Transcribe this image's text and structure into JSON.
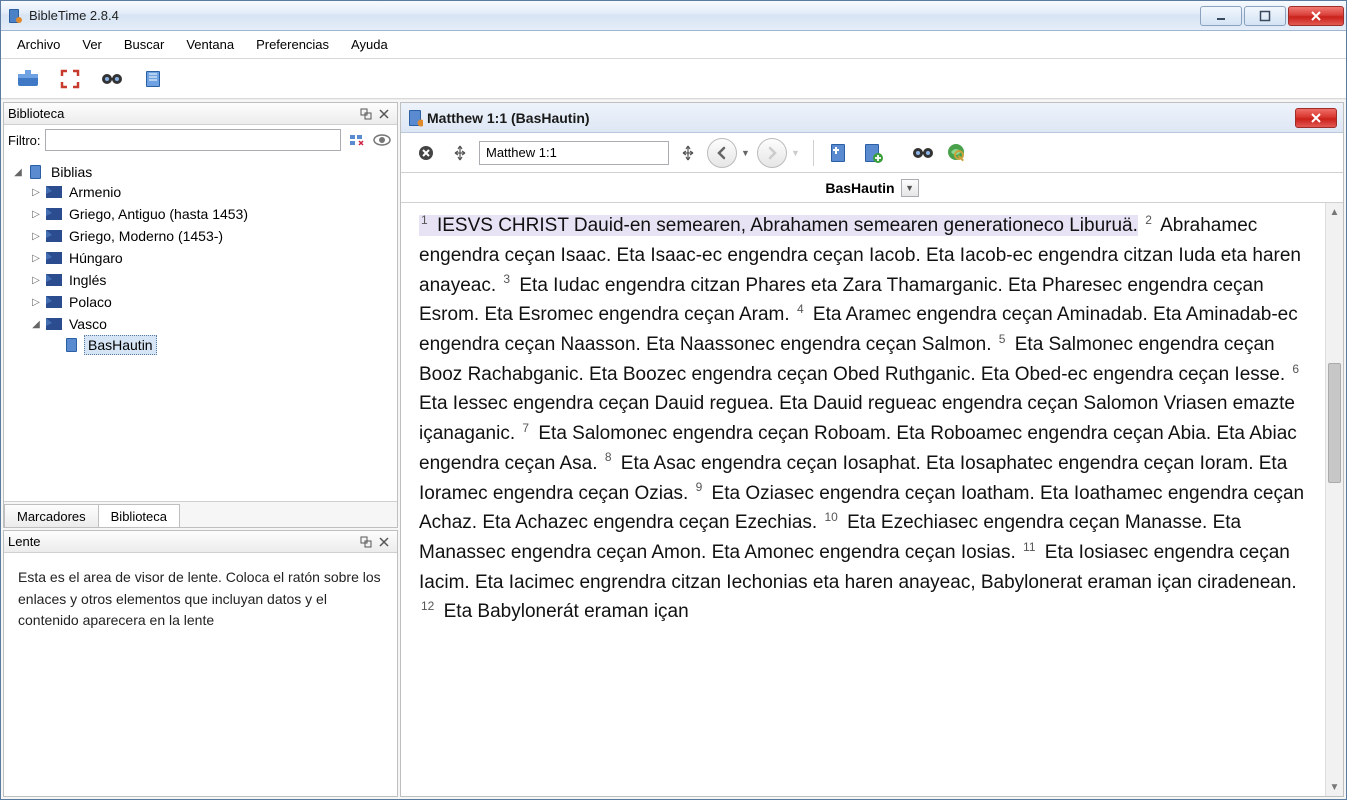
{
  "window": {
    "title": "BibleTime 2.8.4"
  },
  "menu": {
    "items": [
      "Archivo",
      "Ver",
      "Buscar",
      "Ventana",
      "Preferencias",
      "Ayuda"
    ]
  },
  "sidebar": {
    "panel_title": "Biblioteca",
    "filter_label": "Filtro:",
    "filter_value": "",
    "root_label": "Biblias",
    "languages": [
      {
        "label": "Armenio",
        "expanded": false
      },
      {
        "label": "Griego, Antiguo (hasta 1453)",
        "expanded": false
      },
      {
        "label": "Griego, Moderno (1453-)",
        "expanded": false
      },
      {
        "label": "Húngaro",
        "expanded": false
      },
      {
        "label": "Inglés",
        "expanded": false
      },
      {
        "label": "Polaco",
        "expanded": false
      },
      {
        "label": "Vasco",
        "expanded": true,
        "children": [
          {
            "label": "BasHautin"
          }
        ]
      }
    ],
    "tabs": {
      "bookmarks": "Marcadores",
      "library": "Biblioteca"
    }
  },
  "lens": {
    "panel_title": "Lente",
    "body": "Esta es el area de visor de lente. Coloca el ratón sobre los enlaces y otros elementos que incluyan datos y el contenido aparecera en la lente"
  },
  "reader": {
    "tab_title": "Matthew 1:1 (BasHautin)",
    "reference_value": "Matthew 1:1",
    "module_label": "BasHautin",
    "verses": [
      {
        "n": "1",
        "hl": true,
        "t": "IESVS CHRIST Dauid-en semearen, Abrahamen semearen generationeco Liburuä."
      },
      {
        "n": "2",
        "hl": false,
        "t": "Abrahamec engendra ceçan Isaac. Eta Isaac-ec engendra ceçan Iacob. Eta Iacob-ec engendra citzan Iuda eta haren anayeac."
      },
      {
        "n": "3",
        "hl": false,
        "t": "Eta Iudac engendra citzan Phares eta Zara Thamarganic. Eta Pharesec engendra ceçan Esrom. Eta Esromec engendra ceçan Aram."
      },
      {
        "n": "4",
        "hl": false,
        "t": "Eta Aramec engendra ceçan Aminadab. Eta Aminadab-ec engendra ceçan Naasson. Eta Naassonec engendra ceçan Salmon."
      },
      {
        "n": "5",
        "hl": false,
        "t": "Eta Salmonec engendra ceçan Booz Rachabganic. Eta Boozec engendra ceçan Obed Ruthganic. Eta Obed-ec engendra ceçan Iesse."
      },
      {
        "n": "6",
        "hl": false,
        "t": "Eta Iessec engendra ceçan Dauid reguea. Eta Dauid regueac engendra ceçan Salomon Vriasen emazte içanaganic."
      },
      {
        "n": "7",
        "hl": false,
        "t": "Eta Salomonec engendra ceçan Roboam. Eta Roboamec engendra ceçan Abia. Eta Abiac engendra ceçan Asa."
      },
      {
        "n": "8",
        "hl": false,
        "t": "Eta Asac engendra ceçan Iosaphat. Eta Iosaphatec engendra ceçan Ioram. Eta Ioramec engendra ceçan Ozias."
      },
      {
        "n": "9",
        "hl": false,
        "t": "Eta Oziasec engendra ceçan Ioatham. Eta Ioathamec engendra ceçan Achaz. Eta Achazec engendra ceçan Ezechias."
      },
      {
        "n": "10",
        "hl": false,
        "t": "Eta Ezechiasec engendra ceçan Manasse. Eta Manassec engendra ceçan Amon. Eta Amonec engendra ceçan Iosias."
      },
      {
        "n": "11",
        "hl": false,
        "t": "Eta Iosiasec engendra ceçan Iacim. Eta Iacimec engrendra citzan Iechonias eta haren anayeac, Babylonerat eraman içan ciradenean."
      },
      {
        "n": "12",
        "hl": false,
        "t": "Eta Babylonerát eraman içan"
      }
    ]
  }
}
